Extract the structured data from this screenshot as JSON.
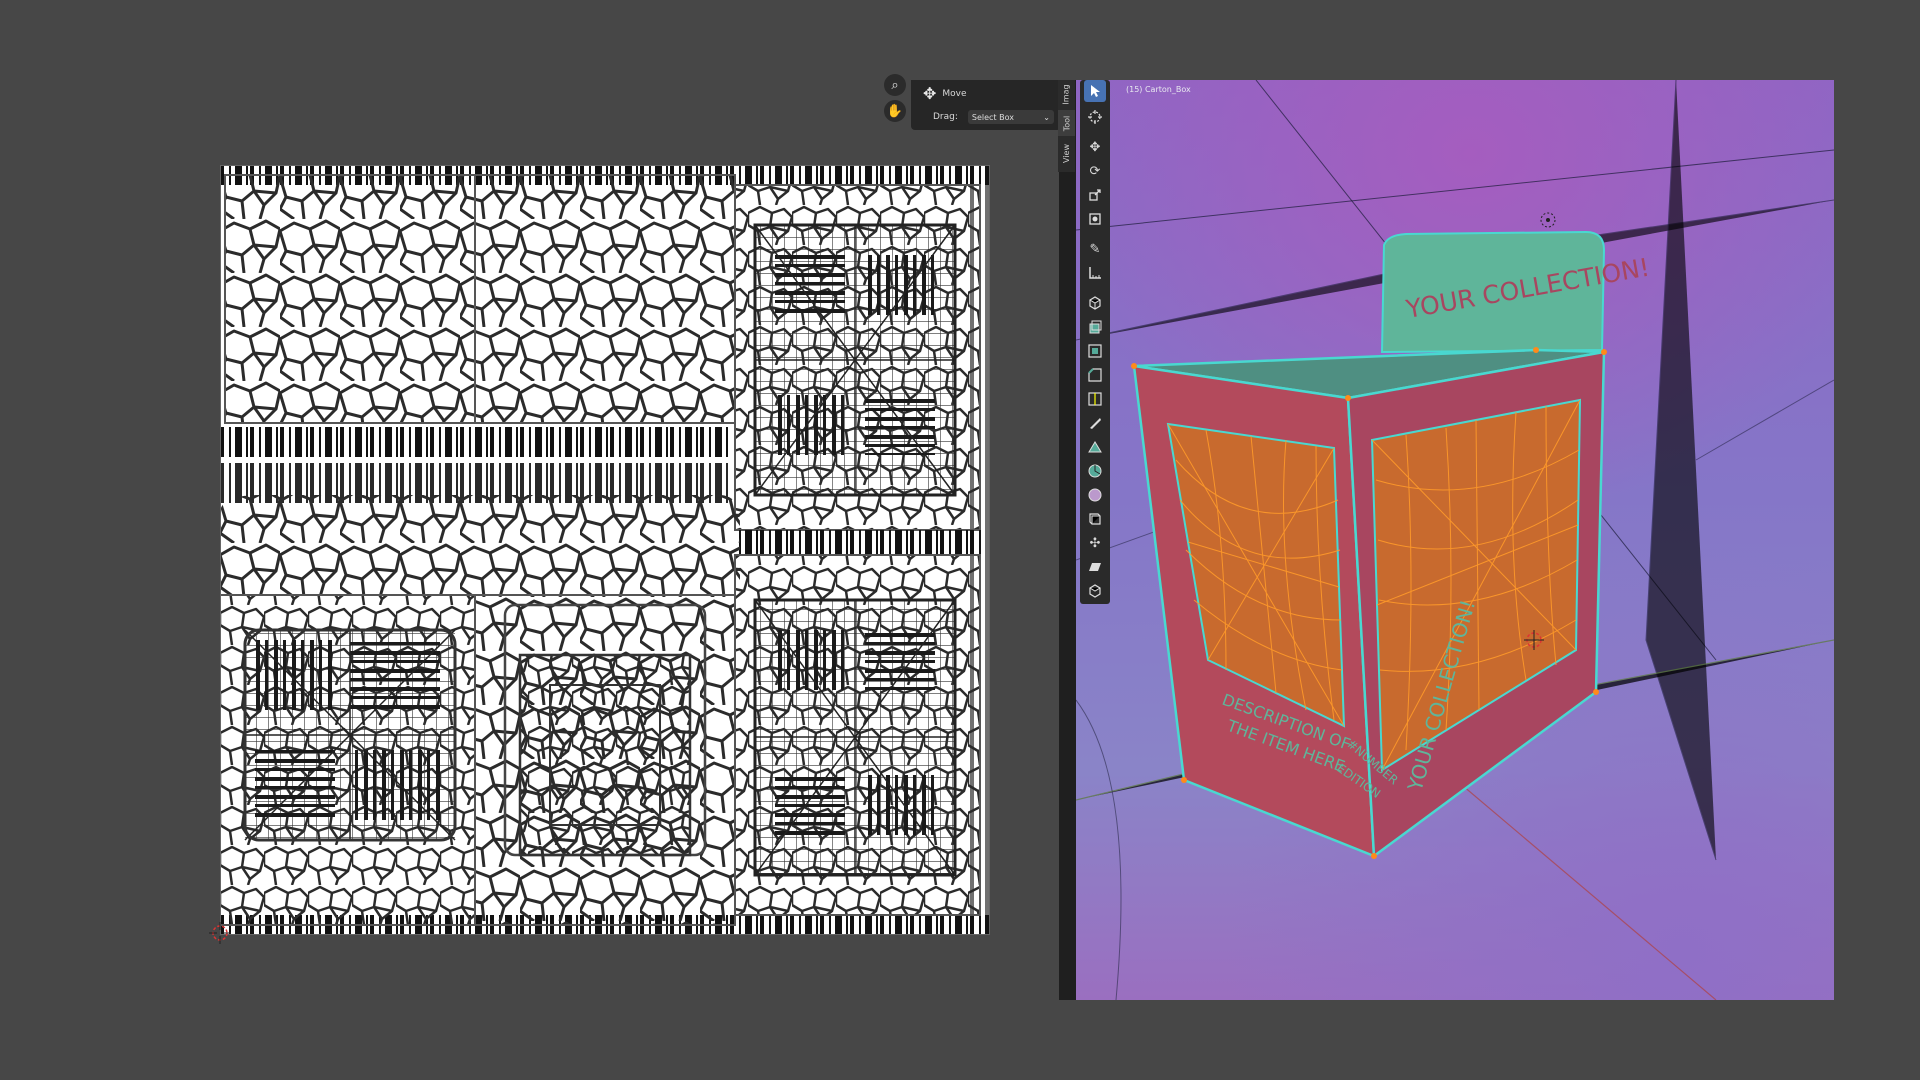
{
  "tool_panel": {
    "tool_name": "Move",
    "drag_label": "Drag:",
    "drag_value": "Select Box"
  },
  "side_tabs": [
    "Imag",
    "Tool",
    "View"
  ],
  "viewport": {
    "object_label": "(15) Carton_Box",
    "box_texts": {
      "header": "YOUR COLLECTION!",
      "side": "YOUR COLLECTION!",
      "description": "DESCRIPTION OF THE ITEM HERE",
      "description_line1": "DESCRIPTION OF",
      "description_line2": "THE ITEM HERE",
      "number_line1": "#NUMBER",
      "number_line2": "EDITION"
    }
  },
  "toolbar": {
    "items": [
      "select-box-icon",
      "cursor-icon",
      "move-icon",
      "rotate-icon",
      "scale-icon",
      "transform-icon",
      "annotate-icon",
      "measure-icon",
      "add-cube-icon",
      "extrude-icon",
      "inset-icon",
      "bevel-icon",
      "loop-cut-icon",
      "knife-icon",
      "poly-build-icon",
      "spin-icon",
      "smooth-icon",
      "edge-slide-icon",
      "shrink-fatten-icon",
      "shear-icon",
      "rip-icon"
    ],
    "active_index": 0
  },
  "colors": {
    "background": "#474747",
    "box_red": "#b34a5c",
    "box_teal": "#5fb59a",
    "wire_orange": "#ff8a1a",
    "edge_cyan": "#49d8d0"
  }
}
